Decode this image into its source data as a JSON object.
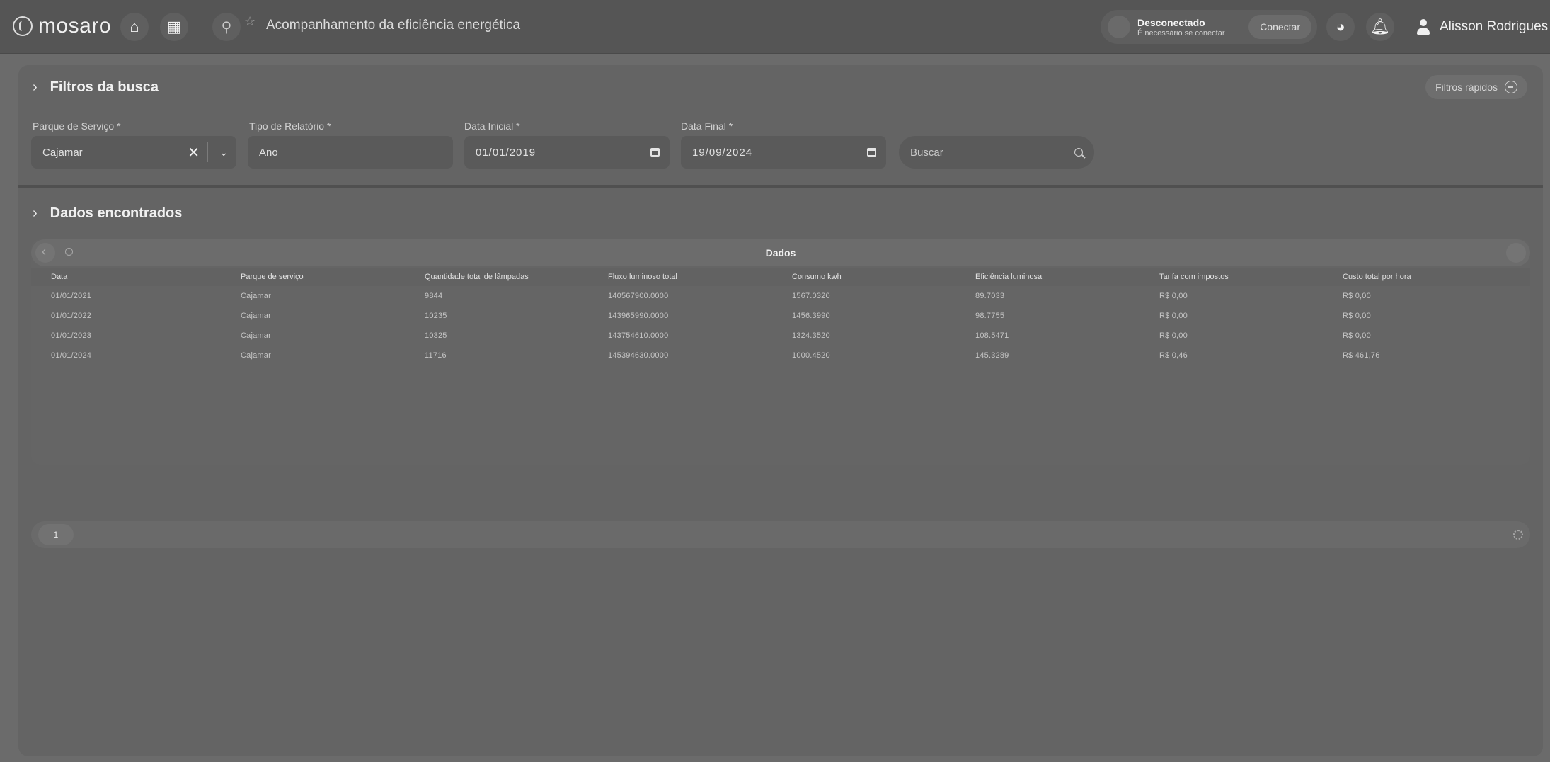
{
  "app": {
    "brand": "mosaro",
    "page_title": "Acompanhamento da eficiência energética"
  },
  "icons": [
    "home-icon",
    "apps-grid-icon",
    "plug-icon",
    "star-icon",
    "palette-icon",
    "bell-icon",
    "user-icon",
    "chevron-right-icon",
    "close-icon",
    "chevron-down-icon",
    "calendar-icon",
    "search-icon",
    "back-icon",
    "settings-icon"
  ],
  "connection": {
    "status": "Desconectado",
    "hint": "É necessário se conectar",
    "button": "Conectar"
  },
  "user": {
    "name": "Alisson Rodrigues"
  },
  "filters": {
    "title": "Filtros da busca",
    "quick_filters": "Filtros rápidos",
    "parque_label": "Parque de Serviço *",
    "parque_value": "Cajamar",
    "tipo_label": "Tipo de Relatório *",
    "tipo_value": "Ano",
    "inicio_label": "Data Inicial *",
    "inicio_value": "01/01/2019",
    "final_label": "Data Final *",
    "final_value": "19/09/2024",
    "search_placeholder": "Buscar"
  },
  "results": {
    "title": "Dados encontrados",
    "table_title": "Dados",
    "columns": [
      "Data",
      "Parque de serviço",
      "Quantidade total de lâmpadas",
      "Fluxo luminoso total",
      "Consumo kwh",
      "Eficiência luminosa",
      "Tarifa com impostos",
      "Custo total por hora"
    ],
    "rows": [
      [
        "01/01/2021",
        "Cajamar",
        "9844",
        "140567900.0000",
        "1567.0320",
        "89.7033",
        "R$ 0,00",
        "R$ 0,00"
      ],
      [
        "01/01/2022",
        "Cajamar",
        "10235",
        "143965990.0000",
        "1456.3990",
        "98.7755",
        "R$ 0,00",
        "R$ 0,00"
      ],
      [
        "01/01/2023",
        "Cajamar",
        "10325",
        "143754610.0000",
        "1324.3520",
        "108.5471",
        "R$ 0,00",
        "R$ 0,00"
      ],
      [
        "01/01/2024",
        "Cajamar",
        "11716",
        "145394630.0000",
        "1000.4520",
        "145.3289",
        "R$ 0,46",
        "R$ 461,76"
      ]
    ],
    "page": "1"
  },
  "colors": {
    "topbar": "#555555",
    "panel": "#646464",
    "background": "#6b6b6b"
  }
}
